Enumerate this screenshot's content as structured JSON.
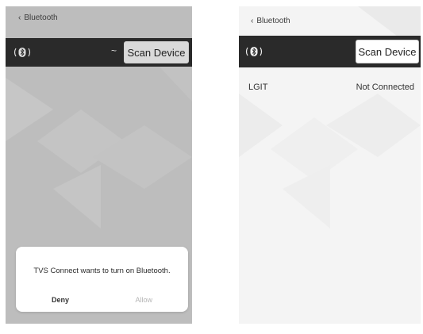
{
  "left_screen": {
    "back_label": "Bluetooth",
    "scan_button_label": "Scan Device",
    "dialog": {
      "message": "TVS Connect wants to turn on Bluetooth.",
      "deny_label": "Deny",
      "allow_label": "Allow"
    }
  },
  "right_screen": {
    "back_label": "Bluetooth",
    "scan_button_label": "Scan Device",
    "devices": [
      {
        "name": "LGIT",
        "status": "Not Connected"
      }
    ]
  },
  "icons": {
    "back": "chevron-left-icon",
    "bluetooth": "bluetooth-signal-icon"
  },
  "colors": {
    "toolbar": "#2a2a2a",
    "overlay_screen": "#bdbdbd",
    "screen_background": "#f4f4f4"
  }
}
